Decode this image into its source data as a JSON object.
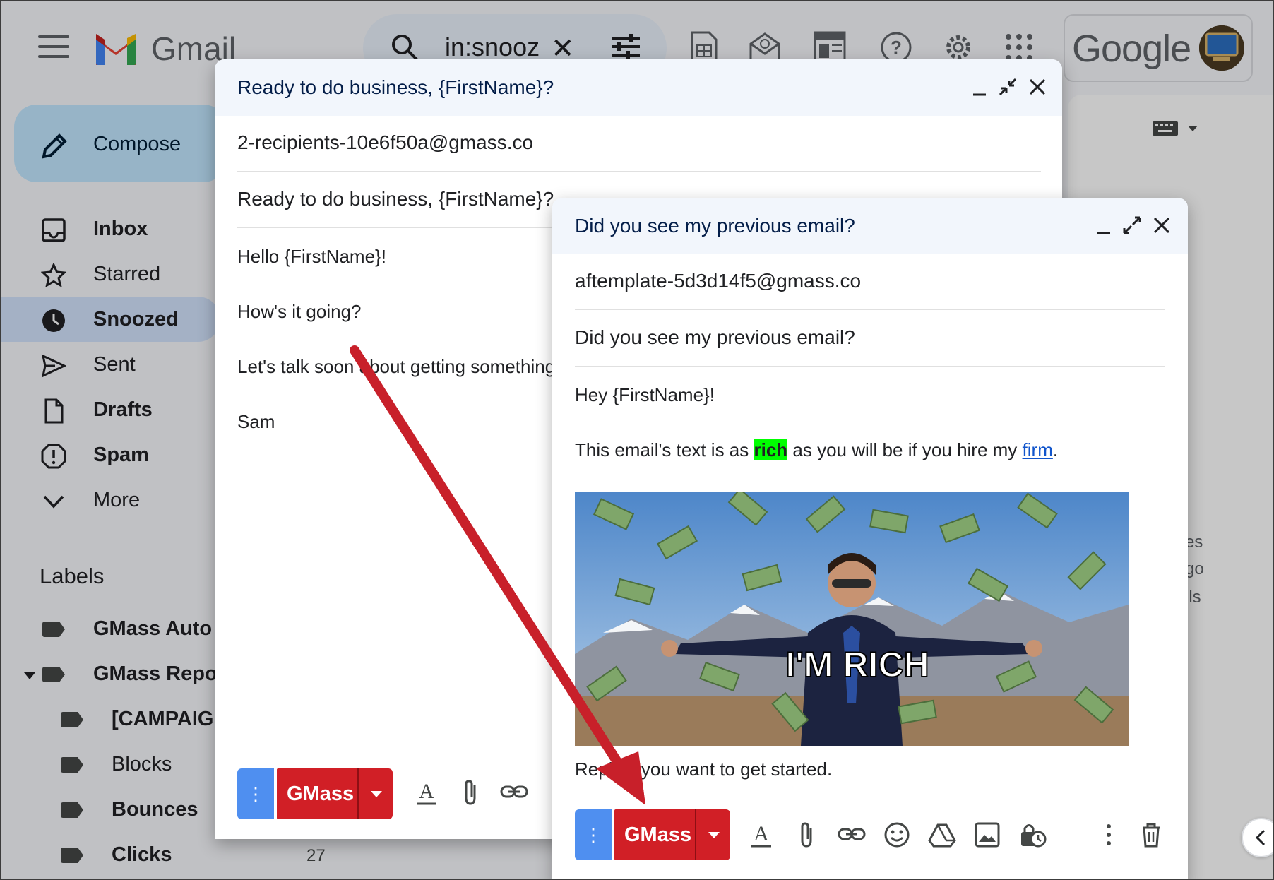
{
  "gmail": {
    "wordmark": "Gmail",
    "search_value": "in:snooz",
    "compose_label": "Compose",
    "nav": [
      {
        "label": "Inbox"
      },
      {
        "label": "Starred"
      },
      {
        "label": "Snoozed"
      },
      {
        "label": "Sent"
      },
      {
        "label": "Drafts"
      },
      {
        "label": "Spam"
      },
      {
        "label": "More"
      }
    ],
    "labels_title": "Labels",
    "labels": [
      {
        "label": "GMass Auto"
      },
      {
        "label": "GMass Repo"
      },
      {
        "label": "[CAMPAIG"
      },
      {
        "label": "Blocks"
      },
      {
        "label": "Bounces"
      },
      {
        "label": "Clicks"
      }
    ],
    "clicks_count": "27",
    "google_wordmark": "Google",
    "right_fragments": [
      "es",
      "go",
      "ils"
    ]
  },
  "compose_back": {
    "title": "Ready to do business, {FirstName}?",
    "to": "2-recipients-10e6f50a@gmass.co",
    "subject": "Ready to do business, {FirstName}?",
    "body": [
      "Hello {FirstName}!",
      "How's it going?",
      "Let's talk soon about getting something",
      "Sam"
    ],
    "gmass_label": "GMass",
    "dots_label": "⋮"
  },
  "compose_front": {
    "title": "Did you see my previous email?",
    "to": "aftemplate-5d3d14f5@gmass.co",
    "subject": "Did you see my previous email?",
    "greeting": "Hey {FirstName}!",
    "line_pre": "This email's text is as ",
    "line_rich": "rich",
    "line_mid": " as you will be if you hire my ",
    "line_link": "firm",
    "line_end": ".",
    "meme_caption": "I'M RICH",
    "reply_line": "Reply if you want to get started.",
    "gmass_label": "GMass",
    "dots_label": "⋮"
  },
  "colors": {
    "gmass_red": "#d11f26",
    "dots_blue": "#4f8ff0",
    "arrow_red": "#c8202a",
    "highlight": "#00ff00"
  }
}
